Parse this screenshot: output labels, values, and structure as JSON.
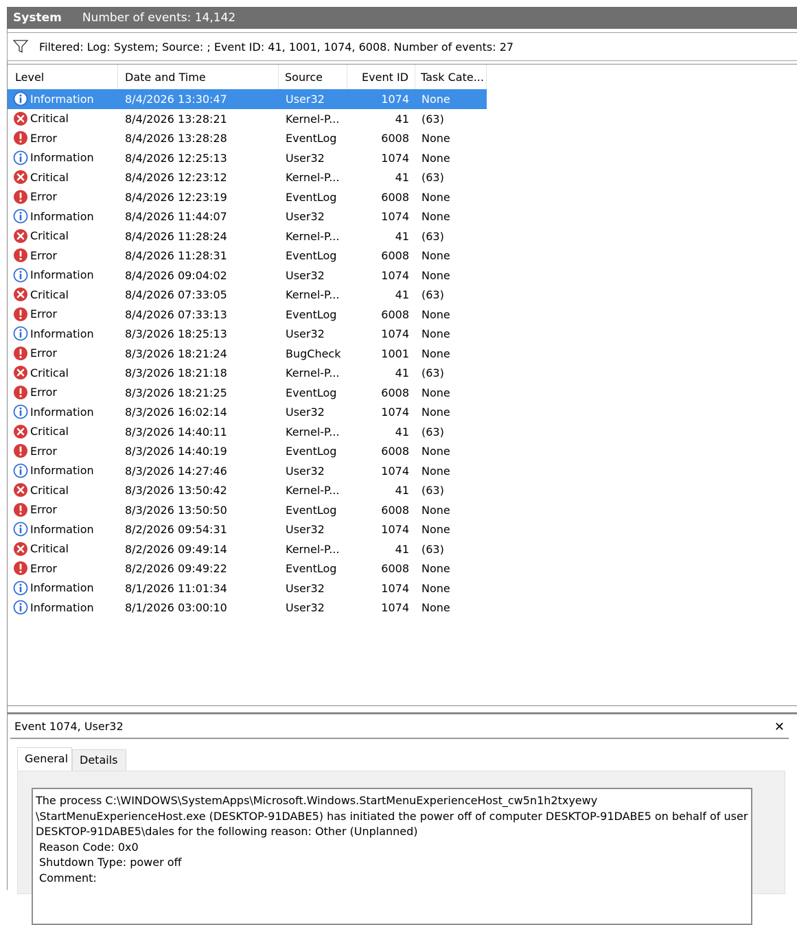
{
  "header": {
    "log_name": "System",
    "event_count_text": "Number of events: 14,142"
  },
  "filter": {
    "icon": "funnel-icon",
    "text": "Filtered: Log: System; Source: ; Event ID: 41, 1001, 1074, 6008. Number of events: 27"
  },
  "columns": {
    "level": "Level",
    "date": "Date and Time",
    "source": "Source",
    "event_id": "Event ID",
    "task": "Task Cate..."
  },
  "colors": {
    "selection": "#3c8ee6",
    "information": "#2e6ed6",
    "critical": "#d63a3a",
    "error": "#d63a3a"
  },
  "events": [
    {
      "level": "Information",
      "date": "8/4/2026 13:30:47",
      "source": "User32",
      "event_id": "1074",
      "task": "None",
      "selected": true
    },
    {
      "level": "Critical",
      "date": "8/4/2026 13:28:21",
      "source": "Kernel-P...",
      "event_id": "41",
      "task": "(63)"
    },
    {
      "level": "Error",
      "date": "8/4/2026 13:28:28",
      "source": "EventLog",
      "event_id": "6008",
      "task": "None"
    },
    {
      "level": "Information",
      "date": "8/4/2026 12:25:13",
      "source": "User32",
      "event_id": "1074",
      "task": "None"
    },
    {
      "level": "Critical",
      "date": "8/4/2026 12:23:12",
      "source": "Kernel-P...",
      "event_id": "41",
      "task": "(63)"
    },
    {
      "level": "Error",
      "date": "8/4/2026 12:23:19",
      "source": "EventLog",
      "event_id": "6008",
      "task": "None"
    },
    {
      "level": "Information",
      "date": "8/4/2026 11:44:07",
      "source": "User32",
      "event_id": "1074",
      "task": "None"
    },
    {
      "level": "Critical",
      "date": "8/4/2026 11:28:24",
      "source": "Kernel-P...",
      "event_id": "41",
      "task": "(63)"
    },
    {
      "level": "Error",
      "date": "8/4/2026 11:28:31",
      "source": "EventLog",
      "event_id": "6008",
      "task": "None"
    },
    {
      "level": "Information",
      "date": "8/4/2026 09:04:02",
      "source": "User32",
      "event_id": "1074",
      "task": "None"
    },
    {
      "level": "Critical",
      "date": "8/4/2026 07:33:05",
      "source": "Kernel-P...",
      "event_id": "41",
      "task": "(63)"
    },
    {
      "level": "Error",
      "date": "8/4/2026 07:33:13",
      "source": "EventLog",
      "event_id": "6008",
      "task": "None"
    },
    {
      "level": "Information",
      "date": "8/3/2026 18:25:13",
      "source": "User32",
      "event_id": "1074",
      "task": "None"
    },
    {
      "level": "Error",
      "date": "8/3/2026 18:21:24",
      "source": "BugCheck",
      "event_id": "1001",
      "task": "None"
    },
    {
      "level": "Critical",
      "date": "8/3/2026 18:21:18",
      "source": "Kernel-P...",
      "event_id": "41",
      "task": "(63)"
    },
    {
      "level": "Error",
      "date": "8/3/2026 18:21:25",
      "source": "EventLog",
      "event_id": "6008",
      "task": "None"
    },
    {
      "level": "Information",
      "date": "8/3/2026 16:02:14",
      "source": "User32",
      "event_id": "1074",
      "task": "None"
    },
    {
      "level": "Critical",
      "date": "8/3/2026 14:40:11",
      "source": "Kernel-P...",
      "event_id": "41",
      "task": "(63)"
    },
    {
      "level": "Error",
      "date": "8/3/2026 14:40:19",
      "source": "EventLog",
      "event_id": "6008",
      "task": "None"
    },
    {
      "level": "Information",
      "date": "8/3/2026 14:27:46",
      "source": "User32",
      "event_id": "1074",
      "task": "None"
    },
    {
      "level": "Critical",
      "date": "8/3/2026 13:50:42",
      "source": "Kernel-P...",
      "event_id": "41",
      "task": "(63)"
    },
    {
      "level": "Error",
      "date": "8/3/2026 13:50:50",
      "source": "EventLog",
      "event_id": "6008",
      "task": "None"
    },
    {
      "level": "Information",
      "date": "8/2/2026 09:54:31",
      "source": "User32",
      "event_id": "1074",
      "task": "None"
    },
    {
      "level": "Critical",
      "date": "8/2/2026 09:49:14",
      "source": "Kernel-P...",
      "event_id": "41",
      "task": "(63)"
    },
    {
      "level": "Error",
      "date": "8/2/2026 09:49:22",
      "source": "EventLog",
      "event_id": "6008",
      "task": "None"
    },
    {
      "level": "Information",
      "date": "8/1/2026 11:01:34",
      "source": "User32",
      "event_id": "1074",
      "task": "None"
    },
    {
      "level": "Information",
      "date": "8/1/2026 03:00:10",
      "source": "User32",
      "event_id": "1074",
      "task": "None"
    }
  ],
  "detail": {
    "title": "Event 1074, User32",
    "close_glyph": "✕",
    "tabs": {
      "general": "General",
      "details": "Details"
    },
    "message_lines": [
      "The process C:\\WINDOWS\\SystemApps\\Microsoft.Windows.StartMenuExperienceHost_cw5n1h2txyewy",
      "\\StartMenuExperienceHost.exe (DESKTOP-91DABE5) has initiated the power off of computer DESKTOP-91DABE5 on behalf of user",
      "DESKTOP-91DABE5\\dales for the following reason: Other (Unplanned)"
    ],
    "reason_code": "Reason Code: 0x0",
    "shutdown_type": "Shutdown Type: power off",
    "comment": "Comment:"
  }
}
